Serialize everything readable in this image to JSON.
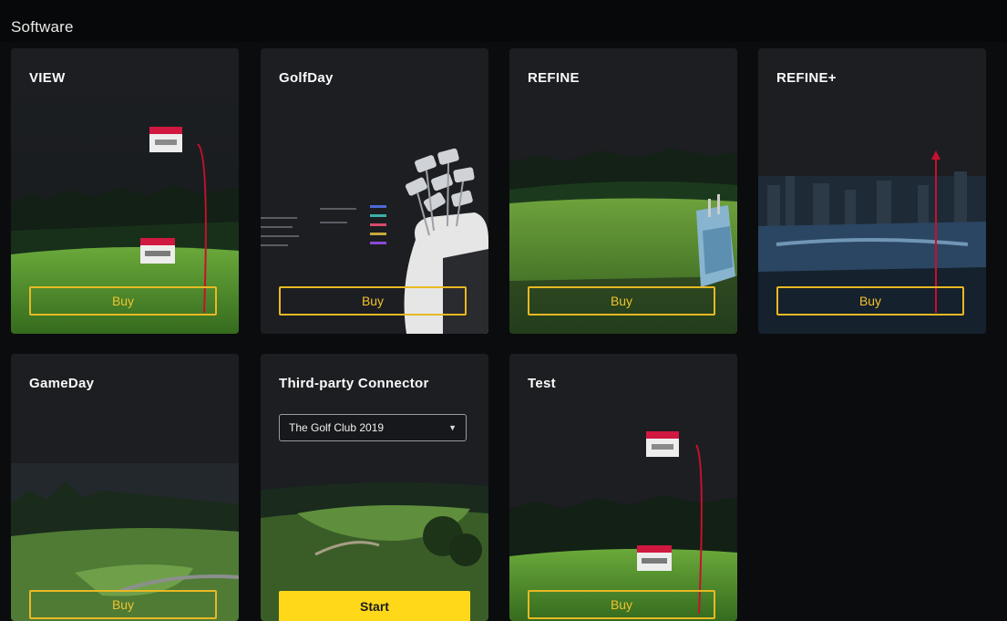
{
  "section": {
    "title": "Software"
  },
  "cards": [
    {
      "name": "VIEW",
      "button": "Buy"
    },
    {
      "name": "GolfDay",
      "button": "Buy"
    },
    {
      "name": "REFINE",
      "button": "Buy"
    },
    {
      "name": "REFINE+",
      "button": "Buy"
    },
    {
      "name": "GameDay",
      "button": "Buy"
    },
    {
      "name": "Third-party Connector",
      "button": "Start",
      "select": {
        "value": "The Golf Club 2019"
      }
    },
    {
      "name": "Test",
      "button": "Buy"
    }
  ],
  "colors": {
    "accent": "#ffd81a",
    "buy_border": "#e8b923",
    "card_bg": "#1c1e22",
    "page_bg": "#0b0c0e",
    "trace_red": "#c8102e"
  },
  "icons": {
    "select_chevron": "chevron-down-icon"
  }
}
